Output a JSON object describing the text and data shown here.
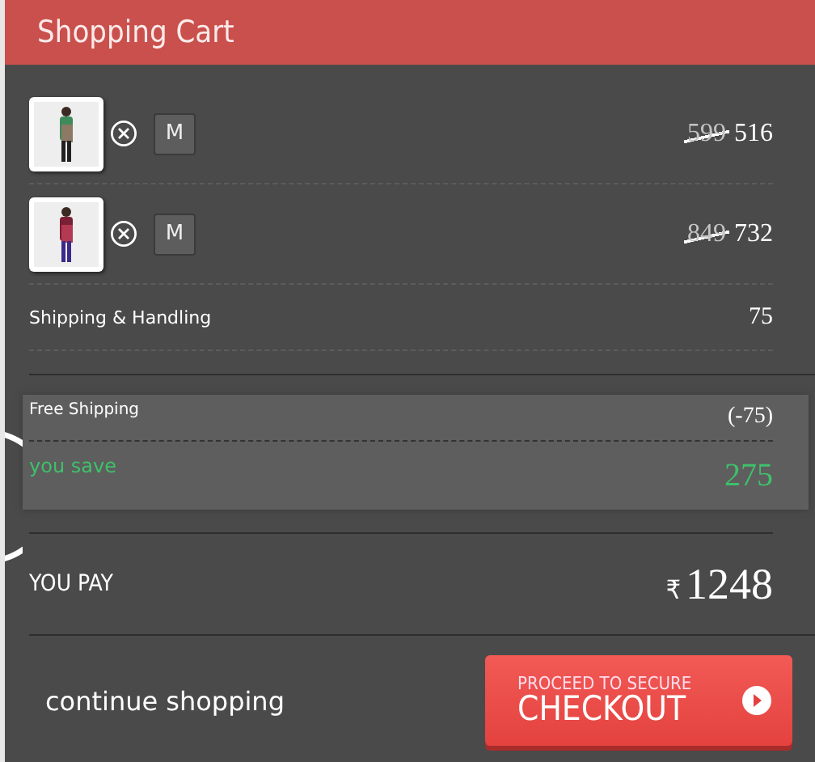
{
  "header": {
    "title": "Shopping Cart"
  },
  "items": [
    {
      "size": "M",
      "original_price": "599",
      "price": "516"
    },
    {
      "size": "M",
      "original_price": "849",
      "price": "732"
    }
  ],
  "shipping": {
    "label": "Shipping & Handling",
    "amount": "75"
  },
  "savings": {
    "free_shipping_label": "Free Shipping",
    "free_shipping_amount": "(-75)",
    "you_save_label": "you save",
    "you_save_amount": "275"
  },
  "total": {
    "label": "YOU PAY",
    "currency": "₹",
    "amount": "1248"
  },
  "actions": {
    "continue": "continue shopping",
    "checkout_top": "PROCEED TO SECURE",
    "checkout_main": "CHECKOUT"
  }
}
